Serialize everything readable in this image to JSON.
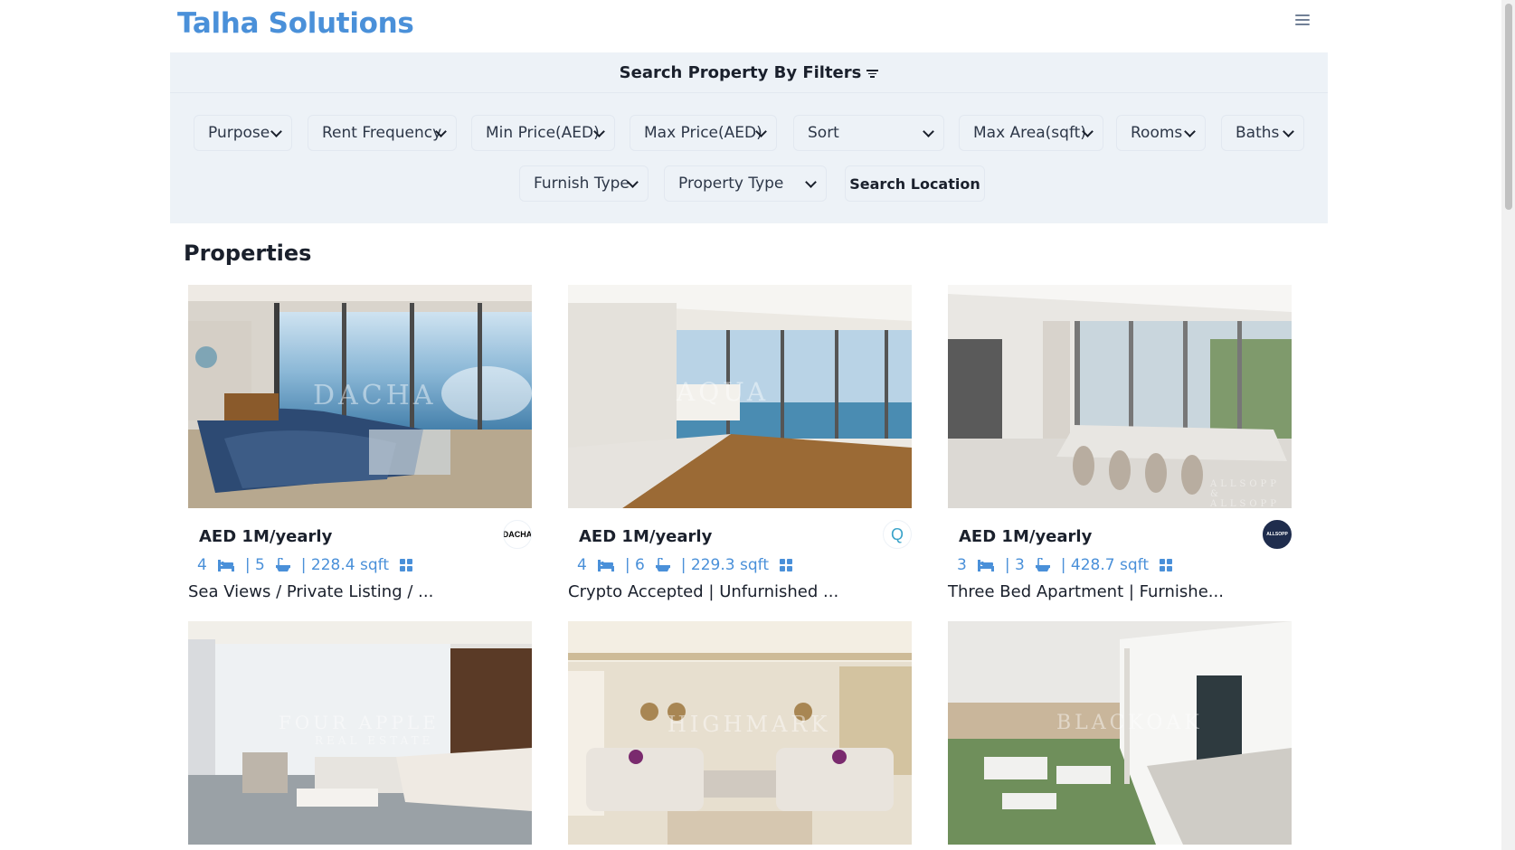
{
  "header": {
    "brand": "Talha Solutions"
  },
  "filters": {
    "title": "Search Property By Filters",
    "row1": [
      {
        "label": "Purpose"
      },
      {
        "label": "Rent Frequency"
      },
      {
        "label": "Min Price(AED)"
      },
      {
        "label": "Max Price(AED)"
      },
      {
        "label": "Sort"
      },
      {
        "label": "Max Area(sqft)"
      },
      {
        "label": "Rooms"
      },
      {
        "label": "Baths"
      }
    ],
    "row2": [
      {
        "label": "Furnish Type"
      },
      {
        "label": "Property Type"
      }
    ],
    "search_location": "Search Location"
  },
  "properties": {
    "heading": "Properties",
    "cards": [
      {
        "price": "AED 1M/yearly",
        "rooms": "4",
        "baths": "| 5",
        "area": "| 228.4 sqft",
        "title": "Sea Views / Private Listing / ...",
        "agency": "DACHA"
      },
      {
        "price": "AED 1M/yearly",
        "rooms": "4",
        "baths": "| 6",
        "area": "| 229.3 sqft",
        "title": "Crypto Accepted | Unfurnished ...",
        "agency": "Q"
      },
      {
        "price": "AED 1M/yearly",
        "rooms": "3",
        "baths": "| 3",
        "area": "| 428.7 sqft",
        "title": "Three Bed Apartment | Furnishe...",
        "agency": "ALLSOPP"
      },
      {
        "watermark": "FOUR APPLE"
      },
      {
        "watermark": "HIGHMARK"
      },
      {
        "watermark": "BLACKOAK"
      }
    ]
  },
  "watermarks": [
    "DACHA",
    "AQUA",
    "ALLSOPP & ALLSOPP",
    "REAL ESTATE"
  ]
}
